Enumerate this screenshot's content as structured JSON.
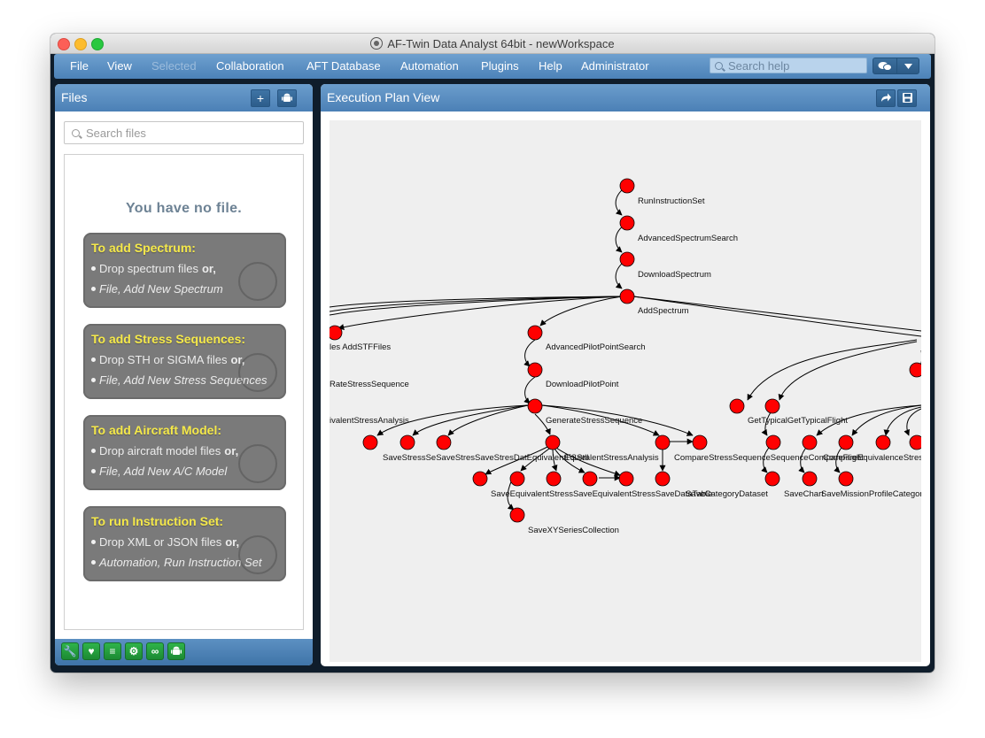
{
  "window": {
    "title": "AF-Twin Data Analyst 64bit - newWorkspace"
  },
  "menu": {
    "file": "File",
    "view": "View",
    "selected": "Selected",
    "collaboration": "Collaboration",
    "aft_database": "AFT Database",
    "automation": "Automation",
    "plugins": "Plugins",
    "help": "Help",
    "administrator": "Administrator"
  },
  "search_help": {
    "placeholder": "Search help"
  },
  "files_panel": {
    "title": "Files",
    "search_placeholder": "Search files",
    "empty_message": "You have no file.",
    "cards": [
      {
        "title": "To add Spectrum:",
        "line1_a": "Drop spectrum files",
        "line1_b": "or,",
        "line2": "File, Add New Spectrum"
      },
      {
        "title": "To add Stress Sequences:",
        "line1_a": "Drop STH or SIGMA files",
        "line1_b": "or,",
        "line2": "File, Add New Stress Sequences"
      },
      {
        "title": "To add Aircraft Model:",
        "line1_a": "Drop aircraft model files",
        "line1_b": "or,",
        "line2": "File, Add New A/C Model"
      },
      {
        "title": "To run Instruction Set:",
        "line1_a": "Drop XML or JSON files",
        "line1_b": "or,",
        "line2": "Automation, Run Instruction Set"
      }
    ],
    "bottom_icons": [
      "wrench-icon",
      "heartbeat-icon",
      "database-icon",
      "gear-icon",
      "link-icon",
      "android-icon"
    ]
  },
  "execution_panel": {
    "title": "Execution Plan View",
    "header_icons": [
      "share-icon",
      "save-icon"
    ],
    "node_color": "#ff0000",
    "labels": {
      "run_instruction_set": "RunInstructionSet",
      "advanced_spectrum_search": "AdvancedSpectrumSearch",
      "download_spectrum": "DownloadSpectrum",
      "add_spectrum": "AddSpectrum",
      "add_stf_files": "les AddSTFFiles",
      "advanced_pilot_point_search": "AdvancedPilotPointSearch",
      "rate_stress_sequence": "RateStressSequence",
      "download_pilot_point": "DownloadPilotPoint",
      "equivalent_stress_analysis_left": "ivalentStressAnalysis",
      "generate_stress_sequence": "GenerateStressSequence",
      "get_typical_flight": "GetTypicalGetTypicalFlight",
      "save_stress_group": "SaveStressSeSaveStresSaveStresDatEquivalentFSStll",
      "equivalent_stress_analysis": "EquivalentStressAnalysis",
      "compare_stress": "CompareStressSequenceSequenceCompareFlight",
      "compare_equivalence": "CompareEquivalenceStress",
      "save_equivalent_group": "SaveEquivalentStressSaveEquivalentStressSaveDataTable",
      "save_category_dataset": "SaveCategoryDataset",
      "save_chart": "SaveChart",
      "save_mission": "SaveMissionProfileCategoryDataset",
      "save_xy_series": "SaveXYSeriesCollection"
    }
  }
}
